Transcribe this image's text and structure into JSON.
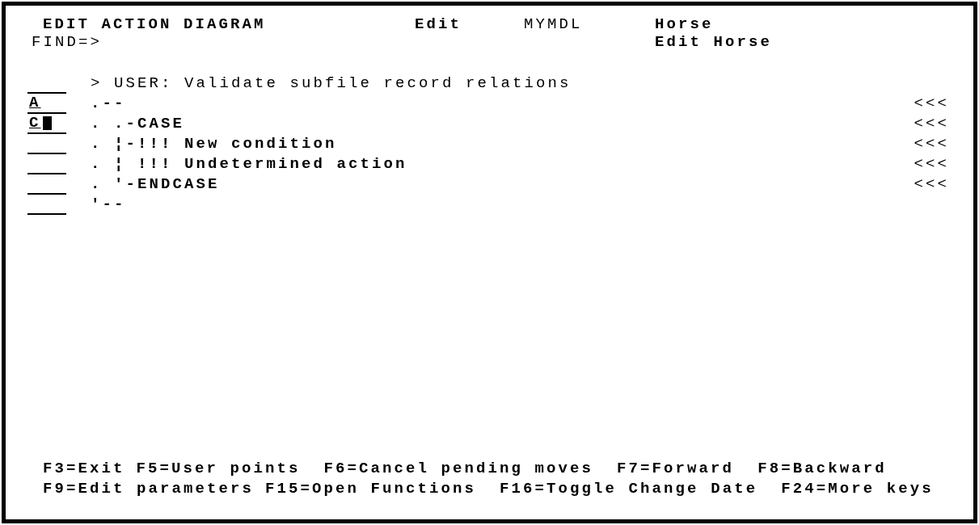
{
  "screen": {
    "title": "EDIT ACTION DIAGRAM",
    "mode": "Edit",
    "model": "MYMDL",
    "object": "Horse",
    "find_label": "FIND=>",
    "function_name": "Edit Horse",
    "lines": [
      {
        "kind": "header",
        "text": "> USER: Validate subfile record relations",
        "cursor": false
      },
      {
        "kind": "construct",
        "command": "A",
        "text": ".--",
        "marker": "<<<",
        "cursor": false
      },
      {
        "kind": "construct",
        "command": "C",
        "text": ". .-CASE",
        "marker": "<<<",
        "cursor": true
      },
      {
        "kind": "construct",
        "text": ". ¦-!!! New condition",
        "marker": "<<<",
        "cursor": false
      },
      {
        "kind": "construct",
        "text": ". ¦ !!! Undetermined action",
        "marker": "<<<",
        "cursor": false
      },
      {
        "kind": "construct",
        "text": ". '-ENDCASE",
        "marker": "<<<",
        "cursor": false
      },
      {
        "kind": "construct",
        "text": "'--",
        "cursor": false
      }
    ],
    "function_keys": [
      [
        "F3=Exit",
        "F5=User points",
        "F6=Cancel pending moves",
        "F7=Forward",
        "F8=Backward"
      ],
      [
        "F9=Edit parameters",
        "F15=Open Functions",
        "F16=Toggle Change Date",
        "F24=More keys"
      ]
    ]
  }
}
